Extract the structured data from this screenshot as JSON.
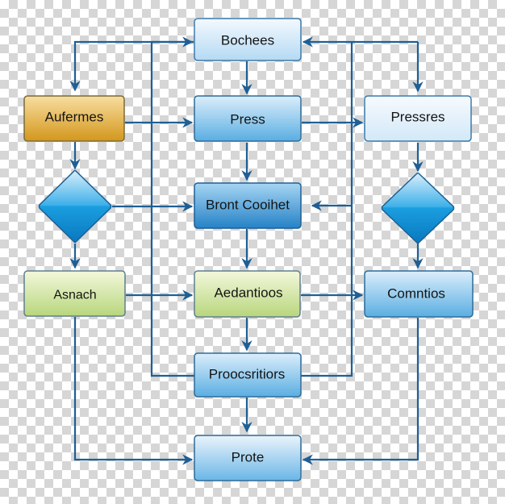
{
  "diagram": {
    "type": "flowchart",
    "nodes": [
      {
        "id": "bochees",
        "shape": "rect",
        "style": "light-blue",
        "label": "Bochees"
      },
      {
        "id": "aufermes",
        "shape": "rect",
        "style": "gold",
        "label": "Aufermes"
      },
      {
        "id": "press",
        "shape": "rect",
        "style": "mid-blue",
        "label": "Press"
      },
      {
        "id": "pressres",
        "shape": "rect",
        "style": "pale-blue",
        "label": "Pressres"
      },
      {
        "id": "decision-left",
        "shape": "diamond",
        "style": "blue",
        "label": ""
      },
      {
        "id": "bront-cooihet",
        "shape": "rect",
        "style": "deep-blue",
        "label": "Bront Cooihet"
      },
      {
        "id": "decision-right",
        "shape": "diamond",
        "style": "blue",
        "label": ""
      },
      {
        "id": "asnach",
        "shape": "rect",
        "style": "green",
        "label": "Asnach"
      },
      {
        "id": "aedantioos",
        "shape": "rect",
        "style": "green",
        "label": "Aedantioos"
      },
      {
        "id": "comntios",
        "shape": "rect",
        "style": "mid-blue",
        "label": "Comntios"
      },
      {
        "id": "proocsritiors",
        "shape": "rect",
        "style": "mid-blue",
        "label": "Proocsritiors"
      },
      {
        "id": "prote",
        "shape": "rect",
        "style": "light-blue",
        "label": "Prote"
      }
    ],
    "edges": [
      {
        "from": "bochees",
        "to": "aufermes"
      },
      {
        "from": "bochees",
        "to": "press"
      },
      {
        "from": "bochees",
        "to": "pressres"
      },
      {
        "from": "aufermes",
        "to": "press"
      },
      {
        "from": "aufermes",
        "to": "decision-left"
      },
      {
        "from": "press",
        "to": "pressres"
      },
      {
        "from": "press",
        "to": "bront-cooihet"
      },
      {
        "from": "decision-left",
        "to": "bront-cooihet"
      },
      {
        "from": "decision-left",
        "to": "asnach"
      },
      {
        "from": "pressres",
        "to": "decision-right"
      },
      {
        "from": "bront-cooihet",
        "to": "aedantioos"
      },
      {
        "from": "decision-right",
        "to": "comntios"
      },
      {
        "from": "asnach",
        "to": "aedantioos"
      },
      {
        "from": "asnach",
        "to": "prote"
      },
      {
        "from": "aedantioos",
        "to": "comntios"
      },
      {
        "from": "aedantioos",
        "to": "proocsritiors"
      },
      {
        "from": "proocsritiors",
        "to": "prote"
      },
      {
        "from": "proocsritiors",
        "to": "bochees"
      },
      {
        "from": "proocsritiors",
        "to": "bront-cooihet"
      },
      {
        "from": "comntios",
        "to": "prote"
      }
    ]
  },
  "colors": {
    "connector": "#1f5f95",
    "border": "#2d6b9a",
    "gold_top": "#f7dc9a",
    "gold_bottom": "#d69a1e",
    "green_top": "#f2f7d8",
    "green_bottom": "#bcd982",
    "blue_top": "#e2f0fb",
    "blue_bottom": "#4ea3db",
    "deep_blue_top": "#9fd0f2",
    "deep_blue_bottom": "#2a86c9",
    "diamond_top": "#cfe8f8",
    "diamond_mid": "#1ea0e0",
    "diamond_bottom": "#0b7cc3"
  }
}
